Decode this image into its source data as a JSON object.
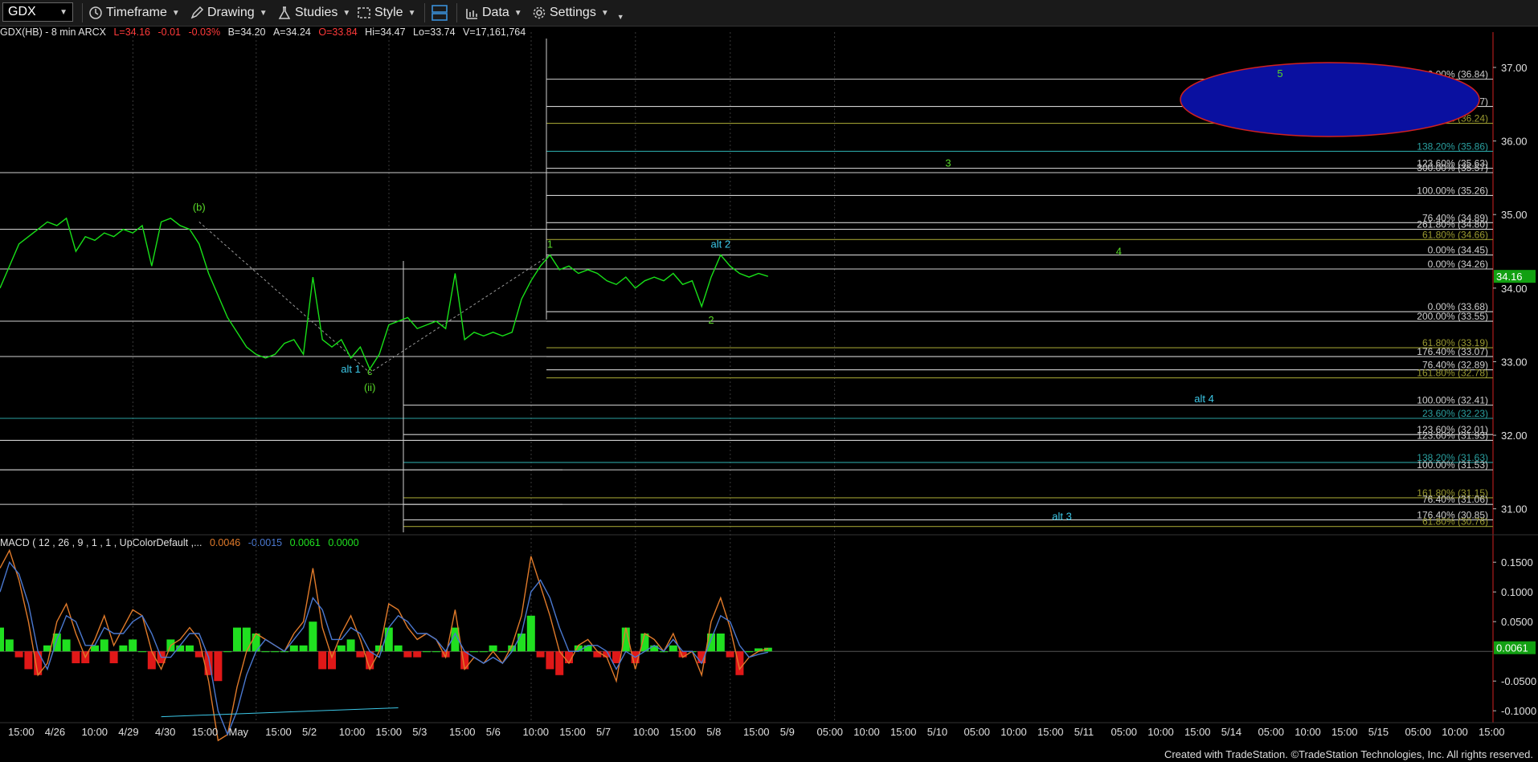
{
  "toolbar": {
    "symbol": "GDX",
    "timeframe": "Timeframe",
    "drawing": "Drawing",
    "studies": "Studies",
    "style": "Style",
    "data": "Data",
    "settings": "Settings"
  },
  "header": {
    "symbol_desc": "GDX(HB) - 8 min  ARCX",
    "last": "L=34.16",
    "change": "-0.01",
    "change_pct": "-0.03%",
    "bid": "B=34.20",
    "ask": "A=34.24",
    "open": "O=33.84",
    "high": "Hi=34.47",
    "low": "Lo=33.74",
    "volume": "V=17,161,764"
  },
  "macd_header": {
    "name": "MACD ( 12 , 26 , 9 , 1 , 1 , UpColorDefault ,...",
    "v1": "0.0046",
    "v2": "-0.0015",
    "v3": "0.0061",
    "v4": "0.0000"
  },
  "footer": "Created with TradeStation. ©TradeStation Technologies, Inc. All rights reserved.",
  "colors": {
    "price": "#18e018",
    "macd_line": "#e07a2a",
    "signal_line": "#4a78d0",
    "hist_up": "#20e020",
    "hist_down": "#e01818",
    "fib_white": "#cfcfcf",
    "fib_teal": "#2aa0a0",
    "fib_olive": "#9a9a30",
    "cyan_label": "#3cc8e8",
    "green_label": "#58d828",
    "target_fill": "#0a10a0",
    "target_stroke": "#d02020"
  },
  "chart_data": [
    {
      "type": "line",
      "title": "GDX(HB) - 8 min ARCX",
      "ylim": [
        30.68,
        37.48
      ],
      "y_ticks": [
        "37.00",
        "36.00",
        "35.00",
        "34.00",
        "33.00",
        "32.00",
        "31.00"
      ],
      "y_tick_values": [
        37.0,
        36.0,
        35.0,
        34.0,
        33.0,
        32.0,
        31.0
      ],
      "x_tick_labels": [
        "15:00",
        "4/26",
        "10:00",
        "4/29",
        "4/30",
        "15:00",
        "May",
        "15:00",
        "5/2",
        "10:00",
        "15:00",
        "5/3",
        "15:00",
        "5/6",
        "10:00",
        "15:00",
        "5/7",
        "10:00",
        "15:00",
        "5/8",
        "15:00",
        "5/9",
        "05:00",
        "10:00",
        "15:00",
        "5/10",
        "05:00",
        "10:00",
        "15:00",
        "5/11",
        "05:00",
        "10:00",
        "15:00",
        "5/14",
        "05:00",
        "10:00",
        "15:00",
        "5/15",
        "05:00",
        "10:00",
        "15:00"
      ],
      "last_price": "34.16",
      "series": [
        {
          "values": [
            34.0,
            34.3,
            34.6,
            34.7,
            34.8,
            34.9,
            34.85,
            34.95,
            34.5,
            34.7,
            34.65,
            34.75,
            34.7,
            34.8,
            34.75,
            34.85,
            34.3,
            34.9,
            34.95,
            34.85,
            34.8,
            34.6,
            34.2,
            33.9,
            33.6,
            33.4,
            33.2,
            33.1,
            33.05,
            33.1,
            33.25,
            33.3,
            33.1,
            34.15,
            33.3,
            33.2,
            33.3,
            33.05,
            33.2,
            32.9,
            33.1,
            33.5,
            33.55,
            33.6,
            33.45,
            33.5,
            33.55,
            33.45,
            34.2,
            33.3,
            33.4,
            33.35,
            33.4,
            33.35,
            33.4,
            33.85,
            34.1,
            34.3,
            34.45,
            34.25,
            34.3,
            34.2,
            34.25,
            34.2,
            34.1,
            34.05,
            34.15,
            34.0,
            34.1,
            34.15,
            34.1,
            34.2,
            34.05,
            34.1,
            33.75,
            34.15,
            34.45,
            34.3,
            34.2,
            34.15,
            34.2,
            34.16
          ]
        }
      ],
      "fib_levels": [
        {
          "label": "200.00% (36.84)",
          "value": 36.84,
          "color": "white"
        },
        {
          "label": "176.40% (36.47)",
          "value": 36.47,
          "color": "white"
        },
        {
          "label": "161.80% (36.24)",
          "value": 36.24,
          "color": "olive"
        },
        {
          "label": "138.20% (35.86)",
          "value": 35.86,
          "color": "teal"
        },
        {
          "label": "123.60% (35.63)",
          "value": 35.63,
          "color": "white"
        },
        {
          "label": "300.00% (35.57)",
          "value": 35.57,
          "color": "white"
        },
        {
          "label": "100.00% (35.26)",
          "value": 35.26,
          "color": "white"
        },
        {
          "label": "76.40% (34.89)",
          "value": 34.89,
          "color": "white"
        },
        {
          "label": "261.80% (34.80)",
          "value": 34.8,
          "color": "white"
        },
        {
          "label": "61.80% (34.66)",
          "value": 34.66,
          "color": "olive"
        },
        {
          "label": "0.00% (34.45)",
          "value": 34.45,
          "color": "white"
        },
        {
          "label": "0.00% (34.26)",
          "value": 34.26,
          "color": "white"
        },
        {
          "label": "0.00% (33.68)",
          "value": 33.68,
          "color": "white"
        },
        {
          "label": "200.00% (33.55)",
          "value": 33.55,
          "color": "white"
        },
        {
          "label": "61.80% (33.19)",
          "value": 33.19,
          "color": "olive"
        },
        {
          "label": "176.40% (33.07)",
          "value": 33.07,
          "color": "white"
        },
        {
          "label": "76.40% (32.89)",
          "value": 32.89,
          "color": "white"
        },
        {
          "label": "161.80% (32.78)",
          "value": 32.78,
          "color": "olive"
        },
        {
          "label": "100.00% (32.41)",
          "value": 32.41,
          "color": "white"
        },
        {
          "label": "23.60% (32.23)",
          "value": 32.23,
          "color": "teal"
        },
        {
          "label": "123.60% (32.01)",
          "value": 32.01,
          "color": "white"
        },
        {
          "label": "123.60% (31.93)",
          "value": 31.93,
          "color": "white"
        },
        {
          "label": "138.20% (31.63)",
          "value": 31.63,
          "color": "teal"
        },
        {
          "label": "100.00% (31.53)",
          "value": 31.53,
          "color": "white"
        },
        {
          "label": "161.80% (31.15)",
          "value": 31.15,
          "color": "olive"
        },
        {
          "label": "76.40% (31.06)",
          "value": 31.06,
          "color": "white"
        },
        {
          "label": "176.40% (30.85)",
          "value": 30.85,
          "color": "white"
        },
        {
          "label": "61.80% (30.76)",
          "value": 30.76,
          "color": "olive"
        }
      ],
      "wave_labels": [
        {
          "text": "(b)",
          "color": "green",
          "bar": 21,
          "price": 35.05
        },
        {
          "text": "alt 1",
          "color": "cyan",
          "bar": 37,
          "price": 32.85
        },
        {
          "text": "c",
          "color": "green",
          "bar": 39,
          "price": 32.82
        },
        {
          "text": "(ii)",
          "color": "green",
          "bar": 39,
          "price": 32.6
        },
        {
          "text": "1",
          "color": "green",
          "bar": 58,
          "price": 34.55
        },
        {
          "text": "alt 2",
          "color": "cyan",
          "bar": 76,
          "price": 34.55
        },
        {
          "text": "2",
          "color": "green",
          "bar": 75,
          "price": 33.52
        },
        {
          "text": "3",
          "color": "green",
          "bar": 100,
          "price": 35.65
        },
        {
          "text": "4",
          "color": "green",
          "bar": 118,
          "price": 34.45
        },
        {
          "text": "5",
          "color": "green",
          "bar": 135,
          "price": 36.87
        },
        {
          "text": "alt 4",
          "color": "cyan",
          "bar": 127,
          "price": 32.45
        },
        {
          "text": "alt 3",
          "color": "cyan",
          "bar": 112,
          "price": 30.85
        }
      ]
    },
    {
      "type": "bar",
      "title": "MACD ( 12 , 26 , 9 , 1 , 1 , UpColorDefault ,...",
      "ylim": [
        -0.12,
        0.18
      ],
      "y_ticks": [
        "0.1500",
        "0.1000",
        "0.0500",
        "-0.0500",
        "-0.1000"
      ],
      "y_tick_values": [
        0.15,
        0.1,
        0.05,
        -0.05,
        -0.1
      ],
      "last_value": "0.0061",
      "series": [
        {
          "name": "MACD",
          "values": [
            0.14,
            0.17,
            0.12,
            0.05,
            -0.04,
            -0.02,
            0.05,
            0.08,
            0.03,
            -0.01,
            0.02,
            0.06,
            0.01,
            0.04,
            0.07,
            0.06,
            0.0,
            -0.03,
            0.01,
            0.02,
            0.04,
            0.02,
            -0.05,
            -0.15,
            -0.14,
            -0.06,
            0.0,
            0.03,
            0.02,
            0.01,
            0.0,
            0.03,
            0.05,
            0.14,
            0.04,
            -0.01,
            0.03,
            0.06,
            0.02,
            -0.03,
            0.0,
            0.08,
            0.07,
            0.04,
            0.02,
            0.03,
            0.02,
            -0.01,
            0.07,
            -0.03,
            -0.01,
            -0.02,
            0.0,
            -0.02,
            0.01,
            0.06,
            0.16,
            0.11,
            0.06,
            0.0,
            -0.02,
            0.01,
            0.02,
            0.0,
            -0.01,
            -0.05,
            0.04,
            -0.03,
            0.03,
            0.02,
            0.0,
            0.03,
            -0.01,
            0.0,
            -0.04,
            0.05,
            0.09,
            0.04,
            -0.03,
            -0.01,
            0.0,
            0.0046
          ]
        },
        {
          "name": "Signal",
          "values": [
            0.1,
            0.15,
            0.13,
            0.08,
            0.0,
            -0.03,
            0.02,
            0.06,
            0.05,
            0.01,
            0.01,
            0.04,
            0.03,
            0.03,
            0.05,
            0.06,
            0.03,
            -0.01,
            -0.01,
            0.01,
            0.03,
            0.03,
            -0.01,
            -0.1,
            -0.14,
            -0.1,
            -0.04,
            0.0,
            0.02,
            0.01,
            0.0,
            0.02,
            0.04,
            0.09,
            0.07,
            0.02,
            0.02,
            0.04,
            0.03,
            0.0,
            -0.01,
            0.04,
            0.06,
            0.05,
            0.03,
            0.03,
            0.02,
            0.0,
            0.03,
            0.0,
            -0.01,
            -0.02,
            -0.01,
            -0.02,
            0.0,
            0.03,
            0.1,
            0.12,
            0.09,
            0.04,
            0.0,
            0.0,
            0.01,
            0.01,
            0.0,
            -0.03,
            0.0,
            -0.01,
            0.0,
            0.01,
            0.0,
            0.02,
            0.0,
            0.0,
            -0.02,
            0.02,
            0.06,
            0.05,
            0.01,
            -0.01,
            -0.005,
            -0.0015
          ]
        },
        {
          "name": "Histogram",
          "values": [
            0.04,
            0.02,
            -0.01,
            -0.03,
            -0.04,
            0.01,
            0.03,
            0.02,
            -0.02,
            -0.02,
            0.01,
            0.02,
            -0.02,
            0.01,
            0.02,
            0.0,
            -0.03,
            -0.02,
            0.02,
            0.01,
            0.01,
            -0.01,
            -0.04,
            -0.05,
            0.0,
            0.04,
            0.04,
            0.03,
            0.0,
            0.0,
            0.0,
            0.01,
            0.01,
            0.05,
            -0.03,
            -0.03,
            0.01,
            0.02,
            -0.01,
            -0.03,
            0.01,
            0.04,
            0.01,
            -0.01,
            -0.01,
            0.0,
            0.0,
            -0.01,
            0.04,
            -0.03,
            0.0,
            0.0,
            0.01,
            0.0,
            0.01,
            0.03,
            0.06,
            -0.01,
            -0.03,
            -0.04,
            -0.02,
            0.01,
            0.01,
            -0.01,
            -0.01,
            -0.02,
            0.04,
            -0.02,
            0.03,
            0.01,
            0.0,
            0.01,
            -0.01,
            0.0,
            -0.02,
            0.03,
            0.03,
            -0.01,
            -0.04,
            0.0,
            0.005,
            0.0061
          ]
        }
      ]
    }
  ]
}
